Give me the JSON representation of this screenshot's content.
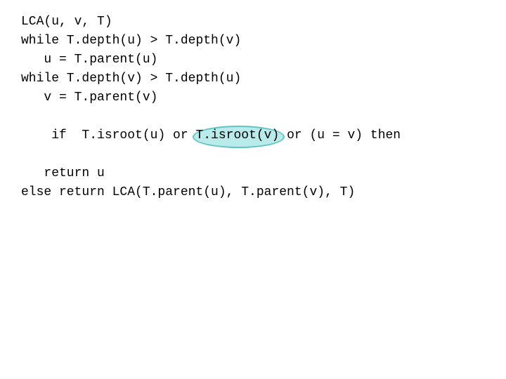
{
  "code": {
    "line1": "LCA(u, v, T)",
    "line2": "while T.depth(u) > T.depth(v)",
    "line3": "   u = T.parent(u)",
    "line4": "while T.depth(v) > T.depth(u)",
    "line5": "   v = T.parent(v)",
    "line6_part1": "if  T.isroot(u) or ",
    "line6_highlight": "T.isroot(v)",
    "line6_part2": " or (u = v) then",
    "line7": "   return u",
    "line8": "else return LCA(T.parent(u), T.parent(v), T)"
  }
}
